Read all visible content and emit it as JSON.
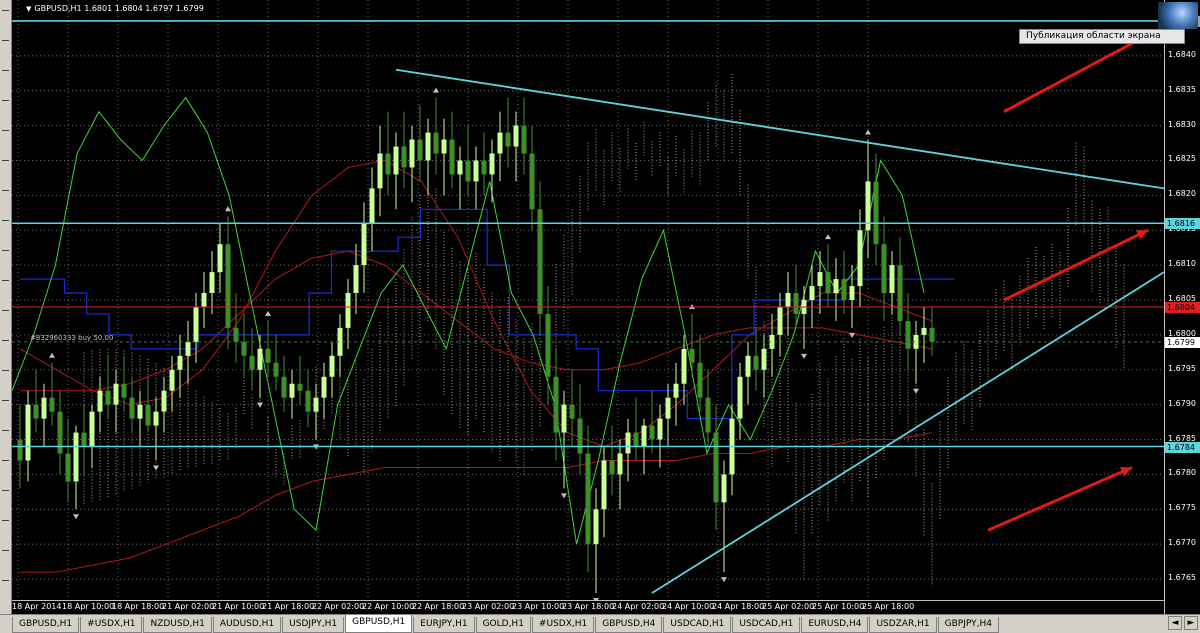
{
  "header": {
    "arrow_icon": "triangle-down-icon",
    "text": "GBPUSD,H1  1.6801 1.6804 1.6797 1.6799"
  },
  "order_label": "#832960333 buy 50.00",
  "publish_label": "Публикация области экрана",
  "price_labels": [
    "1.6840",
    "1.6835",
    "1.6830",
    "1.6825",
    "1.6820",
    "1.6815",
    "1.6810",
    "1.6805",
    "1.6800",
    "1.6795",
    "1.6790",
    "1.6785",
    "1.6780",
    "1.6775",
    "1.6770",
    "1.6765"
  ],
  "price_flags": [
    {
      "text": "1.6845",
      "color": "#9aa0a6",
      "price": 1.6845
    },
    {
      "text": "1.6816",
      "color": "#5ad6e0",
      "price": 1.6816
    },
    {
      "text": "1.6804",
      "color": "#e02020",
      "price": 1.6804
    },
    {
      "text": "1.6799",
      "color": "#ffffff",
      "price": 1.6799
    },
    {
      "text": "1.6784",
      "color": "#5ad6e0",
      "price": 1.6784
    }
  ],
  "time_labels": [
    "18 Apr 2014",
    "18 Apr 10:00",
    "18 Apr 18:00",
    "21 Apr 02:00",
    "21 Apr 10:00",
    "21 Apr 18:00",
    "22 Apr 02:00",
    "22 Apr 10:00",
    "22 Apr 18:00",
    "23 Apr 02:00",
    "23 Apr 10:00",
    "23 Apr 18:00",
    "24 Apr 02:00",
    "24 Apr 10:00",
    "24 Apr 18:00",
    "25 Apr 02:00",
    "25 Apr 10:00",
    "25 Apr 18:00"
  ],
  "tabs": [
    {
      "label": "GBPUSD,H1",
      "active": false
    },
    {
      "label": "#USDX,H1",
      "active": false
    },
    {
      "label": "NZDUSD,H1",
      "active": false
    },
    {
      "label": "AUDUSD,H1",
      "active": false
    },
    {
      "label": "USDJPY,H1",
      "active": false
    },
    {
      "label": "GBPUSD,H1",
      "active": true
    },
    {
      "label": "EURJPY,H1",
      "active": false
    },
    {
      "label": "GOLD,H1",
      "active": false
    },
    {
      "label": "#USDX,H1",
      "active": false
    },
    {
      "label": "GBPUSD,H4",
      "active": false
    },
    {
      "label": "USDCAD,H1",
      "active": false
    },
    {
      "label": "USDCAD,H1",
      "active": false
    },
    {
      "label": "EURUSD,H4",
      "active": false
    },
    {
      "label": "USDZAR,H1",
      "active": false
    },
    {
      "label": "GBPJPY,H4",
      "active": false
    }
  ],
  "colors": {
    "background": "#000000",
    "candle_up": "#c8ff9a",
    "candle_down": "#3f8f2a",
    "horizontal_line": "#5ad6e0",
    "trend_line": "#5ad6e0",
    "red_level": "#e02020",
    "cloud": "#d9c8b0",
    "kijun": "#1a2fd8",
    "ma": "#b01818",
    "chikou": "#38d838",
    "arrow": "#e01a1a"
  },
  "chart_data": {
    "type": "candlestick",
    "symbol": "GBPUSD",
    "timeframe": "H1",
    "ylim": [
      1.6762,
      1.6848
    ],
    "grid": true,
    "horizontal_levels": [
      1.6845,
      1.6816,
      1.6784
    ],
    "red_level": 1.6804,
    "bid_level": 1.6799,
    "trend_lines": [
      {
        "from": {
          "bar": 47,
          "price": 1.6838
        },
        "to": {
          "bar": 143,
          "price": 1.6821
        }
      },
      {
        "from": {
          "bar": 79,
          "price": 1.6763
        },
        "to": {
          "bar": 143,
          "price": 1.6809
        }
      }
    ],
    "candles": [
      [
        1.6785,
        1.679,
        1.6778,
        1.6782
      ],
      [
        1.6782,
        1.6792,
        1.6779,
        1.679
      ],
      [
        1.679,
        1.6795,
        1.6786,
        1.6788
      ],
      [
        1.6788,
        1.6793,
        1.6784,
        1.6791
      ],
      [
        1.6791,
        1.6796,
        1.6787,
        1.6789
      ],
      [
        1.6789,
        1.6792,
        1.678,
        1.6783
      ],
      [
        1.6783,
        1.6788,
        1.6776,
        1.6779
      ],
      [
        1.6779,
        1.6787,
        1.6775,
        1.6786
      ],
      [
        1.6786,
        1.679,
        1.678,
        1.6784
      ],
      [
        1.6784,
        1.679,
        1.6781,
        1.6789
      ],
      [
        1.6789,
        1.6794,
        1.6786,
        1.6792
      ],
      [
        1.6792,
        1.6797,
        1.6788,
        1.679
      ],
      [
        1.679,
        1.6795,
        1.6786,
        1.6793
      ],
      [
        1.6793,
        1.6797,
        1.6789,
        1.6791
      ],
      [
        1.6791,
        1.6794,
        1.6786,
        1.6788
      ],
      [
        1.6788,
        1.6792,
        1.6784,
        1.679
      ],
      [
        1.679,
        1.6794,
        1.6786,
        1.6787
      ],
      [
        1.6787,
        1.6791,
        1.6782,
        1.6789
      ],
      [
        1.6789,
        1.6794,
        1.6786,
        1.6792
      ],
      [
        1.6792,
        1.6797,
        1.6789,
        1.6795
      ],
      [
        1.6795,
        1.68,
        1.6791,
        1.6797
      ],
      [
        1.6797,
        1.6802,
        1.6793,
        1.6799
      ],
      [
        1.6799,
        1.6806,
        1.6796,
        1.6804
      ],
      [
        1.6804,
        1.6809,
        1.6801,
        1.6806
      ],
      [
        1.6806,
        1.6812,
        1.6803,
        1.6809
      ],
      [
        1.6809,
        1.6816,
        1.6806,
        1.6813
      ],
      [
        1.6813,
        1.6817,
        1.6798,
        1.6801
      ],
      [
        1.6801,
        1.6806,
        1.6796,
        1.6799
      ],
      [
        1.6799,
        1.6803,
        1.6794,
        1.6797
      ],
      [
        1.6797,
        1.6801,
        1.6792,
        1.6795
      ],
      [
        1.6795,
        1.68,
        1.6791,
        1.6798
      ],
      [
        1.6798,
        1.6802,
        1.6794,
        1.6796
      ],
      [
        1.6796,
        1.68,
        1.6792,
        1.6794
      ],
      [
        1.6794,
        1.6797,
        1.6789,
        1.6791
      ],
      [
        1.6791,
        1.6795,
        1.6788,
        1.6793
      ],
      [
        1.6793,
        1.6797,
        1.679,
        1.6792
      ],
      [
        1.6792,
        1.6795,
        1.6787,
        1.6789
      ],
      [
        1.6789,
        1.6793,
        1.6785,
        1.6791
      ],
      [
        1.6791,
        1.6796,
        1.6788,
        1.6794
      ],
      [
        1.6794,
        1.6799,
        1.6791,
        1.6797
      ],
      [
        1.6797,
        1.6803,
        1.6794,
        1.6801
      ],
      [
        1.6801,
        1.6808,
        1.6798,
        1.6806
      ],
      [
        1.6806,
        1.6813,
        1.6803,
        1.681
      ],
      [
        1.681,
        1.6819,
        1.6806,
        1.6816
      ],
      [
        1.6816,
        1.6824,
        1.6812,
        1.6821
      ],
      [
        1.6821,
        1.683,
        1.6817,
        1.6826
      ],
      [
        1.6826,
        1.6832,
        1.682,
        1.6823
      ],
      [
        1.6823,
        1.6829,
        1.6818,
        1.6827
      ],
      [
        1.6827,
        1.6832,
        1.6821,
        1.6824
      ],
      [
        1.6824,
        1.683,
        1.6819,
        1.6828
      ],
      [
        1.6828,
        1.6833,
        1.6822,
        1.6825
      ],
      [
        1.6825,
        1.6831,
        1.682,
        1.6829
      ],
      [
        1.6829,
        1.6834,
        1.6823,
        1.6826
      ],
      [
        1.6826,
        1.6831,
        1.682,
        1.6828
      ],
      [
        1.6828,
        1.6832,
        1.6821,
        1.6823
      ],
      [
        1.6823,
        1.6827,
        1.6818,
        1.6825
      ],
      [
        1.6825,
        1.683,
        1.682,
        1.6822
      ],
      [
        1.6822,
        1.6827,
        1.6818,
        1.6825
      ],
      [
        1.6825,
        1.6829,
        1.682,
        1.6823
      ],
      [
        1.6823,
        1.6828,
        1.6819,
        1.6826
      ],
      [
        1.6826,
        1.6832,
        1.6822,
        1.6829
      ],
      [
        1.6829,
        1.6834,
        1.6824,
        1.6827
      ],
      [
        1.6827,
        1.6832,
        1.6822,
        1.683
      ],
      [
        1.683,
        1.6834,
        1.6823,
        1.6826
      ],
      [
        1.6826,
        1.683,
        1.6815,
        1.6818
      ],
      [
        1.6818,
        1.6822,
        1.68,
        1.6803
      ],
      [
        1.6803,
        1.6807,
        1.679,
        1.6794
      ],
      [
        1.6794,
        1.6798,
        1.6782,
        1.6786
      ],
      [
        1.6786,
        1.6792,
        1.6778,
        1.679
      ],
      [
        1.679,
        1.6795,
        1.6784,
        1.6788
      ],
      [
        1.6788,
        1.6793,
        1.678,
        1.6783
      ],
      [
        1.6783,
        1.6787,
        1.6766,
        1.677
      ],
      [
        1.677,
        1.6778,
        1.6763,
        1.6775
      ],
      [
        1.6775,
        1.6784,
        1.6771,
        1.6782
      ],
      [
        1.6782,
        1.6787,
        1.6777,
        1.678
      ],
      [
        1.678,
        1.6785,
        1.6775,
        1.6783
      ],
      [
        1.6783,
        1.6788,
        1.6779,
        1.6786
      ],
      [
        1.6786,
        1.6791,
        1.6782,
        1.6784
      ],
      [
        1.6784,
        1.6788,
        1.678,
        1.6787
      ],
      [
        1.6787,
        1.6792,
        1.6783,
        1.6785
      ],
      [
        1.6785,
        1.679,
        1.6781,
        1.6788
      ],
      [
        1.6788,
        1.6793,
        1.6784,
        1.6791
      ],
      [
        1.6791,
        1.6796,
        1.6787,
        1.6793
      ],
      [
        1.6793,
        1.68,
        1.679,
        1.6798
      ],
      [
        1.6798,
        1.6803,
        1.6794,
        1.6796
      ],
      [
        1.6796,
        1.68,
        1.6789,
        1.6791
      ],
      [
        1.6791,
        1.6795,
        1.6784,
        1.6786
      ],
      [
        1.6786,
        1.679,
        1.6772,
        1.6776
      ],
      [
        1.6776,
        1.6782,
        1.6766,
        1.678
      ],
      [
        1.678,
        1.679,
        1.6777,
        1.6788
      ],
      [
        1.6788,
        1.6796,
        1.6785,
        1.6794
      ],
      [
        1.6794,
        1.6799,
        1.679,
        1.6797
      ],
      [
        1.6797,
        1.6801,
        1.6792,
        1.6795
      ],
      [
        1.6795,
        1.68,
        1.6791,
        1.6798
      ],
      [
        1.6798,
        1.6803,
        1.6794,
        1.68
      ],
      [
        1.68,
        1.6806,
        1.6797,
        1.6804
      ],
      [
        1.6804,
        1.6809,
        1.68,
        1.6806
      ],
      [
        1.6806,
        1.681,
        1.6801,
        1.6803
      ],
      [
        1.6803,
        1.6807,
        1.6798,
        1.6805
      ],
      [
        1.6805,
        1.681,
        1.6801,
        1.6807
      ],
      [
        1.6807,
        1.6812,
        1.6803,
        1.6809
      ],
      [
        1.6809,
        1.6813,
        1.6804,
        1.6806
      ],
      [
        1.6806,
        1.6811,
        1.6802,
        1.6808
      ],
      [
        1.6808,
        1.6812,
        1.6803,
        1.6805
      ],
      [
        1.6805,
        1.681,
        1.6801,
        1.6807
      ],
      [
        1.6807,
        1.6818,
        1.6804,
        1.6815
      ],
      [
        1.6815,
        1.6828,
        1.6811,
        1.6822
      ],
      [
        1.6822,
        1.6826,
        1.681,
        1.6813
      ],
      [
        1.6813,
        1.6817,
        1.6802,
        1.6806
      ],
      [
        1.6806,
        1.6812,
        1.6803,
        1.681
      ],
      [
        1.681,
        1.6814,
        1.68,
        1.6802
      ],
      [
        1.6802,
        1.6806,
        1.6795,
        1.6798
      ],
      [
        1.6798,
        1.6802,
        1.6793,
        1.68
      ],
      [
        1.68,
        1.6804,
        1.6796,
        1.6801
      ],
      [
        1.6801,
        1.6804,
        1.6797,
        1.6799
      ]
    ],
    "kijun_sen": [
      1.6808,
      1.6808,
      1.6806,
      1.6803,
      1.68,
      1.6798,
      1.6798,
      1.6798,
      1.68,
      1.68,
      1.68,
      1.68,
      1.68,
      1.6806,
      1.6812,
      1.6812,
      1.6812,
      1.6814,
      1.6818,
      1.6818,
      1.6818,
      1.681,
      1.68,
      1.68,
      1.68,
      1.6798,
      1.6792,
      1.6792,
      1.6792,
      1.6792,
      1.6788,
      1.6788,
      1.68,
      1.6805,
      1.6805,
      1.6805,
      1.6805,
      1.6808,
      1.6808,
      1.6808,
      1.6808,
      1.6808
    ],
    "chikou_span": [
      1.6792,
      1.68,
      1.681,
      1.6826,
      1.6832,
      1.6828,
      1.6825,
      1.683,
      1.6834,
      1.6829,
      1.682,
      1.6805,
      1.679,
      1.6775,
      1.6772,
      1.679,
      1.6798,
      1.6806,
      1.681,
      1.6804,
      1.6798,
      1.681,
      1.6822,
      1.6806,
      1.68,
      1.679,
      1.677,
      1.6782,
      1.6796,
      1.6808,
      1.6815,
      1.68,
      1.6783,
      1.679,
      1.6785,
      1.6792,
      1.68,
      1.6812,
      1.6806,
      1.681,
      1.6825,
      1.682,
      1.6806
    ],
    "moving_averages": [
      [
        1.6798,
        1.6795,
        1.6792,
        1.679,
        1.6791,
        1.6795,
        1.6802,
        1.6812,
        1.682,
        1.6824,
        1.6825,
        1.6822,
        1.6814,
        1.6802,
        1.6792,
        1.6786,
        1.6784,
        1.6786,
        1.679,
        1.6795,
        1.68,
        1.6803,
        1.6806,
        1.6806,
        1.6804,
        1.6802
      ],
      [
        1.6792,
        1.6792,
        1.6792,
        1.6793,
        1.6795,
        1.6798,
        1.6803,
        1.6808,
        1.6811,
        1.6812,
        1.681,
        1.6806,
        1.6802,
        1.6798,
        1.6796,
        1.6795,
        1.6795,
        1.6796,
        1.6798,
        1.68,
        1.6801,
        1.6801,
        1.6801,
        1.68,
        1.6799,
        1.6798
      ],
      [
        1.6766,
        1.6766,
        1.6767,
        1.6768,
        1.677,
        1.6772,
        1.6774,
        1.6777,
        1.6779,
        1.678,
        1.6781,
        1.6781,
        1.6781,
        1.6781,
        1.6781,
        1.6781,
        1.6782,
        1.6782,
        1.6782,
        1.6783,
        1.6783,
        1.6784,
        1.6784,
        1.6785,
        1.6785,
        1.6786
      ]
    ],
    "arrows": [
      {
        "from": {
          "bar": 123,
          "price": 1.6832
        },
        "to": {
          "bar": 141,
          "price": 1.6843
        }
      },
      {
        "from": {
          "bar": 123,
          "price": 1.6805
        },
        "to": {
          "bar": 141,
          "price": 1.6815
        }
      },
      {
        "from": {
          "bar": 121,
          "price": 1.6772
        },
        "to": {
          "bar": 139,
          "price": 1.6781
        }
      }
    ]
  }
}
